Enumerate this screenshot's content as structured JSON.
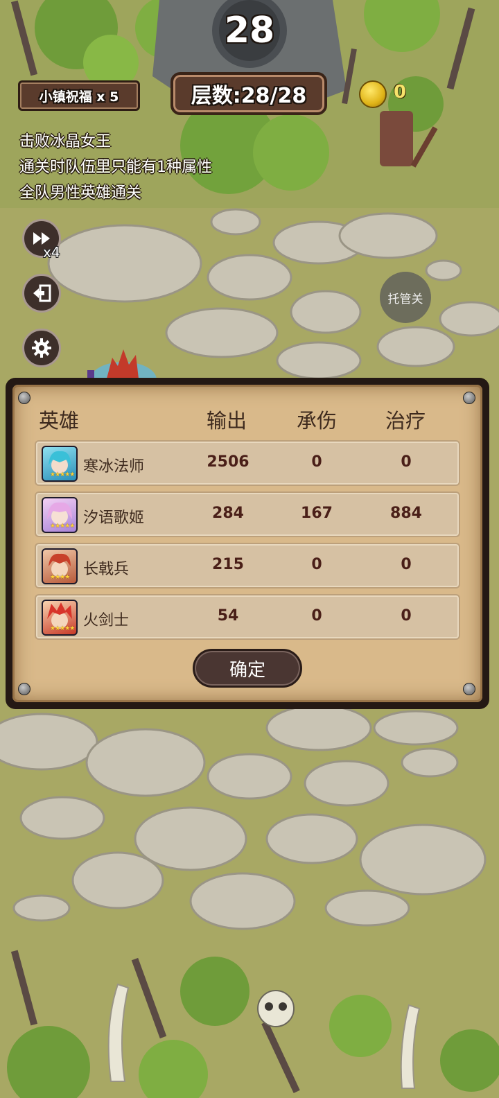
{
  "hud": {
    "round_number": "28",
    "floor_label": "层数:28/28",
    "blessing_label": "小镇祝福 x 5",
    "coin_count": "0"
  },
  "objectives": [
    "击败冰晶女王",
    "通关时队伍里只能有1种属性",
    "全队男性英雄通关"
  ],
  "side_buttons": {
    "speed_multiplier": "x4",
    "auto_label": "托管关"
  },
  "stats_panel": {
    "headers": {
      "hero": "英雄",
      "output": "输出",
      "damage_taken": "承伤",
      "healing": "治疗"
    },
    "rows": [
      {
        "name": "寒冰法师",
        "output": "2506",
        "damage_taken": "0",
        "healing": "0",
        "portrait": "ice-mage-portrait",
        "accent": "#3aa8c9"
      },
      {
        "name": "汐语歌姬",
        "output": "284",
        "damage_taken": "167",
        "healing": "884",
        "portrait": "songstress-portrait",
        "accent": "#d89ad8"
      },
      {
        "name": "长戟兵",
        "output": "215",
        "damage_taken": "0",
        "healing": "0",
        "portrait": "halberdier-portrait",
        "accent": "#c0462e"
      },
      {
        "name": "火剑士",
        "output": "54",
        "damage_taken": "0",
        "healing": "0",
        "portrait": "fire-swordsman-portrait",
        "accent": "#d8442a"
      }
    ],
    "confirm_label": "确定"
  },
  "colors": {
    "panel_bg": "#d9b98a",
    "row_bg": "#d6c1a3",
    "number_text": "#4a1f18",
    "grass": "#a8a864",
    "stone": "#c9c4b4"
  }
}
